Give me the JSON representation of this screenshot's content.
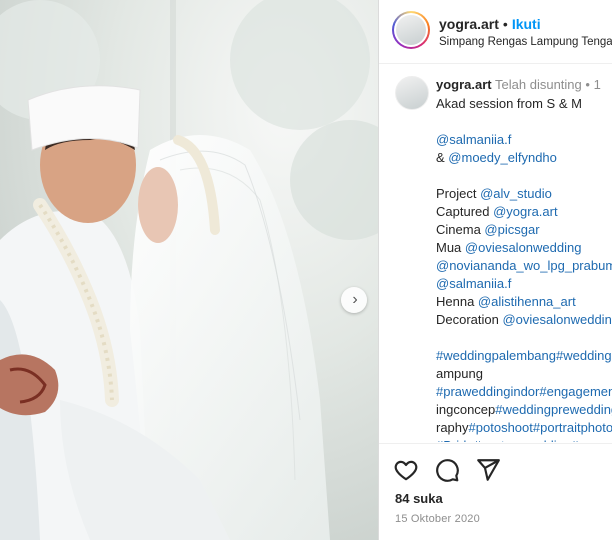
{
  "post": {
    "username": "yogra.art",
    "follow_label": "Ikuti",
    "location": "Simpang Rengas Lampung Tengah",
    "edited_label": "Telah disunting",
    "edited_sep": "•",
    "edited_time": "1",
    "caption_lines": [
      "Akad session from S & M",
      "",
      "@salmaniia.f",
      "& @moedy_elfyndho",
      "",
      "Project @alv_studio",
      "Captured @yogra.art",
      "Cinema @picsgar",
      "Mua @oviesalonwedding",
      "@noviananda_wo_lpg_prabumulih",
      "@salmaniia.f",
      "Henna @alistihenna_art",
      "Decoration @oviesalonwedding",
      "",
      "#weddingpalembang#weddinglampung",
      "ampung",
      "#praweddingindor#engagement",
      "ingconcep#weddingpreweddingphotog",
      "raphy#potoshoot#portraitphotography",
      "#Bride#customwedding#"
    ],
    "likes": "84 suka",
    "date": "15 Oktober 2020"
  },
  "icons": {
    "like": "heart-icon",
    "comment": "comment-icon",
    "share": "send-icon",
    "next": "chevron-right-icon"
  },
  "colors": {
    "follow": "#0095f6",
    "link": "#1e6ab0",
    "muted": "#8e8e8e"
  }
}
